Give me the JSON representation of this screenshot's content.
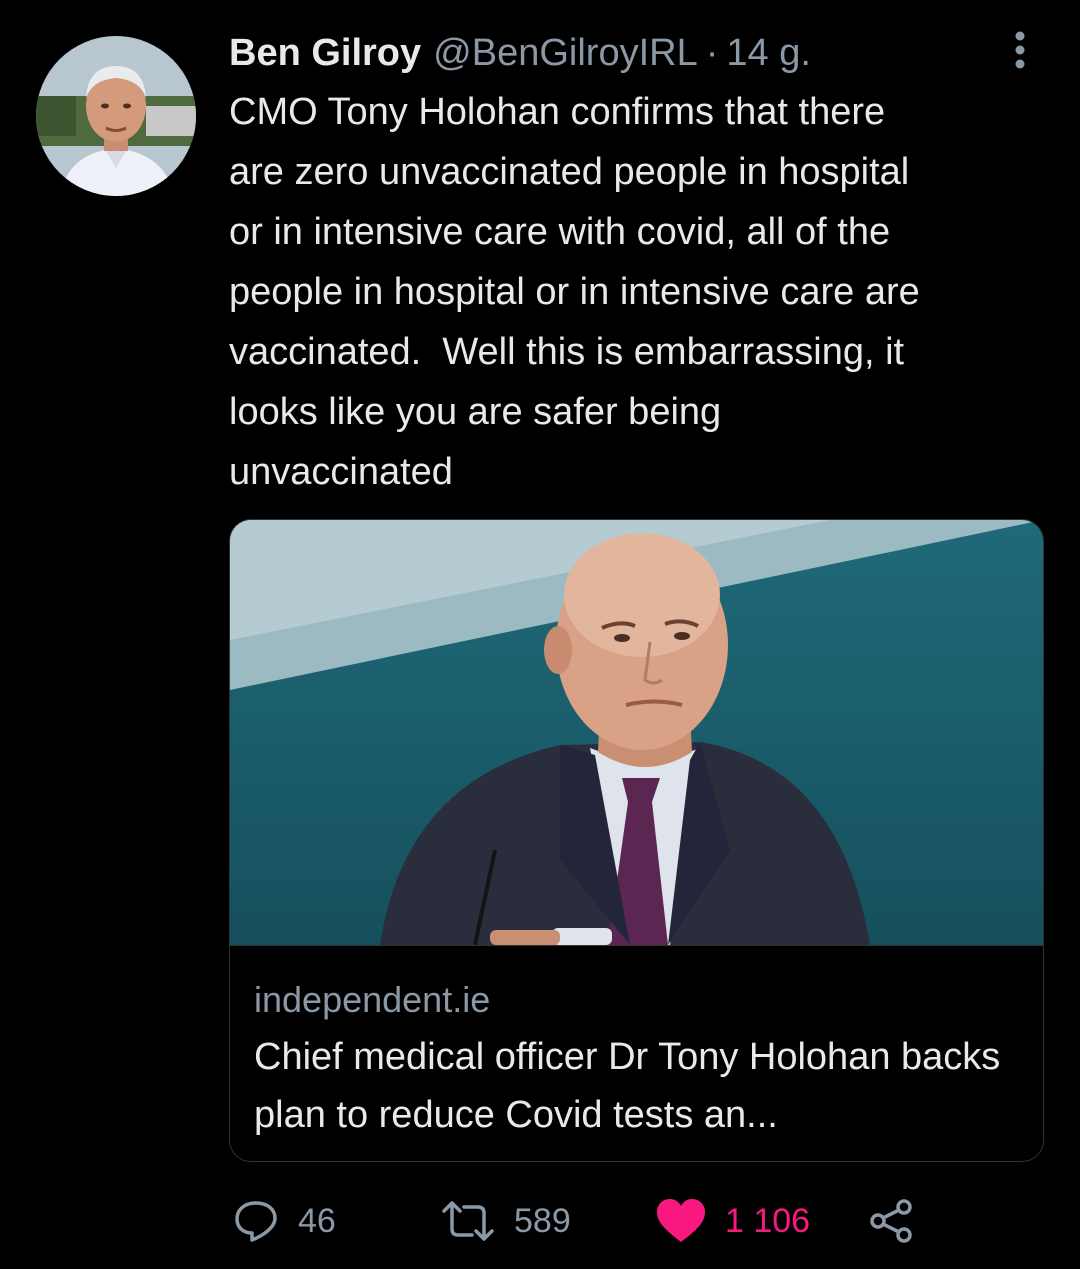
{
  "tweet": {
    "author": {
      "display_name": "Ben Gilroy",
      "handle": "@BenGilroyIRL",
      "separator": "·",
      "time": "14 g."
    },
    "text": "CMO Tony Holohan confirms that there\nare zero unvaccinated people in hospital\nor in intensive care with covid, all of the\npeople in hospital or in intensive care are\nvaccinated.  Well this is embarrassing, it\nlooks like you are safer being\nunvaccinated",
    "card": {
      "domain": "independent.ie",
      "title": "Chief medical officer Dr Tony Holohan backs plan to reduce Covid tests an..."
    },
    "actions": {
      "replies": "46",
      "retweets": "589",
      "likes": "1 106"
    }
  },
  "icons": {
    "more": "more-vertical-icon",
    "reply": "reply-icon",
    "retweet": "retweet-icon",
    "like": "heart-icon",
    "share": "share-icon"
  },
  "colors": {
    "background": "#000000",
    "text": "#e7e9ea",
    "secondary": "#8b98a5",
    "like": "#f91880",
    "border": "#2f3336"
  }
}
